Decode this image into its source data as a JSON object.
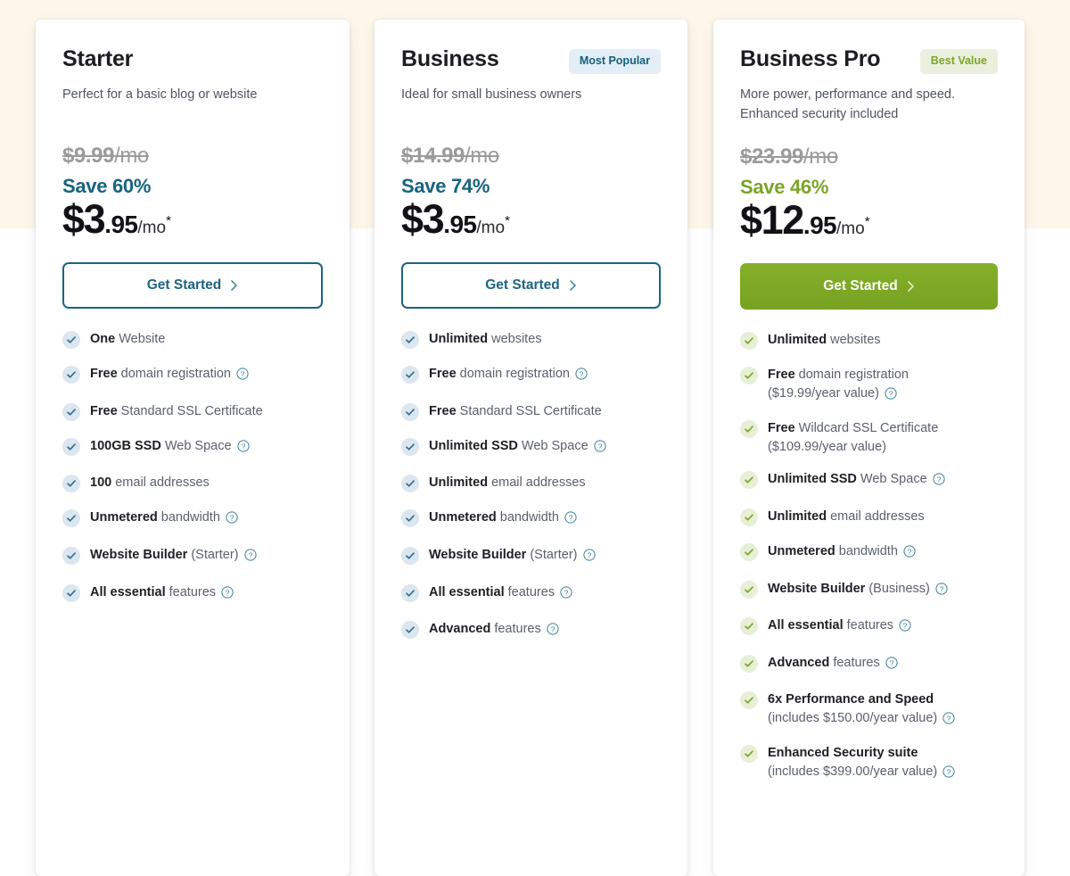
{
  "page": {
    "background_top_color": "#fdf7e9",
    "background_color": "#ffffff"
  },
  "icons": {
    "check": "check-icon",
    "info": "info-help-icon",
    "chevron": "chevron-right-icon"
  },
  "colors": {
    "teal": "#17647f",
    "green": "#7ba428",
    "badge_popular_bg": "#e3eef7",
    "badge_popular_text": "#15607c",
    "badge_best_bg": "#ebf0de",
    "badge_best_text": "#7ba428",
    "cta_outline": "#1b6480",
    "cta_solid": "#7ba428",
    "old_price": "#9b9b9e"
  },
  "plans": [
    {
      "name": "Starter",
      "badge": null,
      "tagline": "Perfect for a basic blog or website",
      "old_price": "$9.99",
      "old_price_unit": "/mo",
      "save": "Save 60%",
      "save_color": "teal",
      "price_whole": "$3",
      "price_cents": ".95",
      "price_per": "/mo",
      "price_star": "*",
      "cta_label": "Get Started",
      "cta_style": "outline",
      "check_style": "blue",
      "features": [
        {
          "strong": "One",
          "rest": " Website",
          "sub": null,
          "info": false
        },
        {
          "strong": "Free",
          "rest": " domain registration",
          "sub": null,
          "info": true
        },
        {
          "strong": "Free",
          "rest": " Standard SSL Certificate",
          "sub": null,
          "info": false
        },
        {
          "strong": "100GB SSD",
          "rest": " Web Space",
          "sub": null,
          "info": true
        },
        {
          "strong": "100",
          "rest": " email addresses",
          "sub": null,
          "info": false
        },
        {
          "strong": "Unmetered",
          "rest": " bandwidth",
          "sub": null,
          "info": true
        },
        {
          "strong": "Website Builder",
          "rest": " (Starter)",
          "sub": null,
          "info": true
        },
        {
          "strong": "All essential",
          "rest": " features",
          "sub": null,
          "info": true
        }
      ]
    },
    {
      "name": "Business",
      "badge": "Most Popular",
      "badge_style": "popular",
      "tagline": "Ideal for small business owners",
      "old_price": "$14.99",
      "old_price_unit": "/mo",
      "save": "Save 74%",
      "save_color": "teal",
      "price_whole": "$3",
      "price_cents": ".95",
      "price_per": "/mo",
      "price_star": "*",
      "cta_label": "Get Started",
      "cta_style": "outline",
      "check_style": "blue",
      "features": [
        {
          "strong": "Unlimited",
          "rest": " websites",
          "sub": null,
          "info": false
        },
        {
          "strong": "Free",
          "rest": " domain registration",
          "sub": null,
          "info": true
        },
        {
          "strong": "Free",
          "rest": " Standard SSL Certificate",
          "sub": null,
          "info": false
        },
        {
          "strong": "Unlimited SSD",
          "rest": " Web Space",
          "sub": null,
          "info": true
        },
        {
          "strong": "Unlimited",
          "rest": " email addresses",
          "sub": null,
          "info": false
        },
        {
          "strong": "Unmetered",
          "rest": " bandwidth",
          "sub": null,
          "info": true
        },
        {
          "strong": "Website Builder",
          "rest": " (Starter)",
          "sub": null,
          "info": true
        },
        {
          "strong": "All essential",
          "rest": " features",
          "sub": null,
          "info": true
        },
        {
          "strong": "Advanced",
          "rest": " features",
          "sub": null,
          "info": true
        }
      ]
    },
    {
      "name": "Business Pro",
      "badge": "Best Value",
      "badge_style": "best",
      "tagline": "More power, performance and speed. Enhanced security included",
      "old_price": "$23.99",
      "old_price_unit": "/mo",
      "save": "Save 46%",
      "save_color": "green",
      "price_whole": "$12",
      "price_cents": ".95",
      "price_per": "/mo",
      "price_star": "*",
      "cta_label": "Get Started",
      "cta_style": "solid",
      "check_style": "green",
      "features": [
        {
          "strong": "Unlimited",
          "rest": " websites",
          "sub": null,
          "info": false
        },
        {
          "strong": "Free",
          "rest": " domain registration",
          "sub": "($19.99/year value)",
          "info": true
        },
        {
          "strong": "Free",
          "rest": " Wildcard SSL Certificate",
          "sub": "($109.99/year value)",
          "info": false
        },
        {
          "strong": "Unlimited SSD",
          "rest": " Web Space",
          "sub": null,
          "info": true
        },
        {
          "strong": "Unlimited",
          "rest": " email addresses",
          "sub": null,
          "info": false
        },
        {
          "strong": "Unmetered",
          "rest": " bandwidth",
          "sub": null,
          "info": true
        },
        {
          "strong": "Website Builder",
          "rest": " (Business)",
          "sub": null,
          "info": true
        },
        {
          "strong": "All essential",
          "rest": " features",
          "sub": null,
          "info": true
        },
        {
          "strong": "Advanced",
          "rest": " features",
          "sub": null,
          "info": true
        },
        {
          "strong": "6x Performance and Speed",
          "rest": "",
          "sub": "(includes $150.00/year value)",
          "info": true
        },
        {
          "strong": "Enhanced Security suite",
          "rest": "",
          "sub": "(includes $399.00/year value)",
          "info": true
        }
      ]
    }
  ]
}
